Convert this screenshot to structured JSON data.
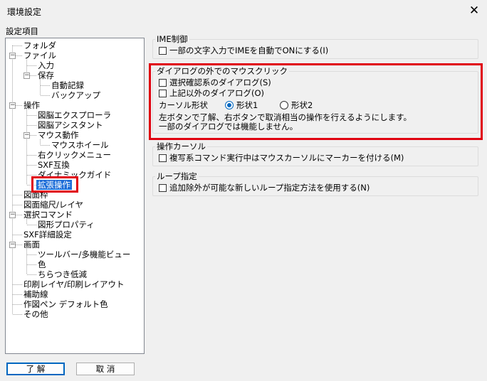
{
  "window": {
    "title": "環境設定",
    "close_glyph": "✕"
  },
  "tree": {
    "caption": "設定項目",
    "items": [
      {
        "label": "フォルダ"
      },
      {
        "label": "ファイル",
        "expander": "−"
      },
      {
        "label": "入力"
      },
      {
        "label": "保存",
        "expander": "−"
      },
      {
        "label": "自動記録"
      },
      {
        "label": "バックアップ"
      },
      {
        "label": "操作",
        "expander": "−"
      },
      {
        "label": "図脳エクスプローラ"
      },
      {
        "label": "図脳アシスタント"
      },
      {
        "label": "マウス動作",
        "expander": "−"
      },
      {
        "label": "マウスホイール"
      },
      {
        "label": "右クリックメニュー"
      },
      {
        "label": "SXF互換"
      },
      {
        "label": "ダイナミックガイド"
      },
      {
        "label": "拡張操作",
        "selected": true
      },
      {
        "label": "図面枠"
      },
      {
        "label": "図面縮尺/レイヤ"
      },
      {
        "label": "選択コマンド",
        "expander": "−"
      },
      {
        "label": "図形プロパティ"
      },
      {
        "label": "SXF詳細設定"
      },
      {
        "label": "画面",
        "expander": "−"
      },
      {
        "label": "ツールバー/多機能ビュー"
      },
      {
        "label": "色"
      },
      {
        "label": "ちらつき低減"
      },
      {
        "label": "印刷レイヤ/印刷レイアウト"
      },
      {
        "label": "補助線"
      },
      {
        "label": "作図ペン デフォルト色"
      },
      {
        "label": "その他"
      }
    ]
  },
  "ime": {
    "title": "IME制御",
    "option": {
      "label": "一部の文字入力でIMEを自動でONにする(I)",
      "checked": false
    }
  },
  "dialog_click": {
    "title": "ダイアログの外でのマウスクリック",
    "options": [
      {
        "label": "選択確認系のダイアログ(S)",
        "checked": false
      },
      {
        "label": "上記以外のダイアログ(O)",
        "checked": false
      }
    ],
    "cursor_shape_label": "カーソル形状",
    "shapes": [
      {
        "label": "形状1",
        "selected": true
      },
      {
        "label": "形状2",
        "selected": false
      }
    ],
    "note_line1": "左ボタンで了解、右ボタンで取消相当の操作を行えるようにします。",
    "note_line2": "一部のダイアログでは機能しません。"
  },
  "cursor": {
    "title": "操作カーソル",
    "option": {
      "label": "複写系コマンド実行中はマウスカーソルにマーカーを付ける(M)",
      "checked": false
    }
  },
  "loop": {
    "title": "ループ指定",
    "option": {
      "label": "追加除外が可能な新しいループ指定方法を使用する(N)",
      "checked": false
    }
  },
  "buttons": {
    "ok": "了 解",
    "cancel": "取 消"
  },
  "colors": {
    "highlight_box": "#e00010",
    "selection": "#1e6fd9",
    "radio_accent": "#0067c0"
  }
}
